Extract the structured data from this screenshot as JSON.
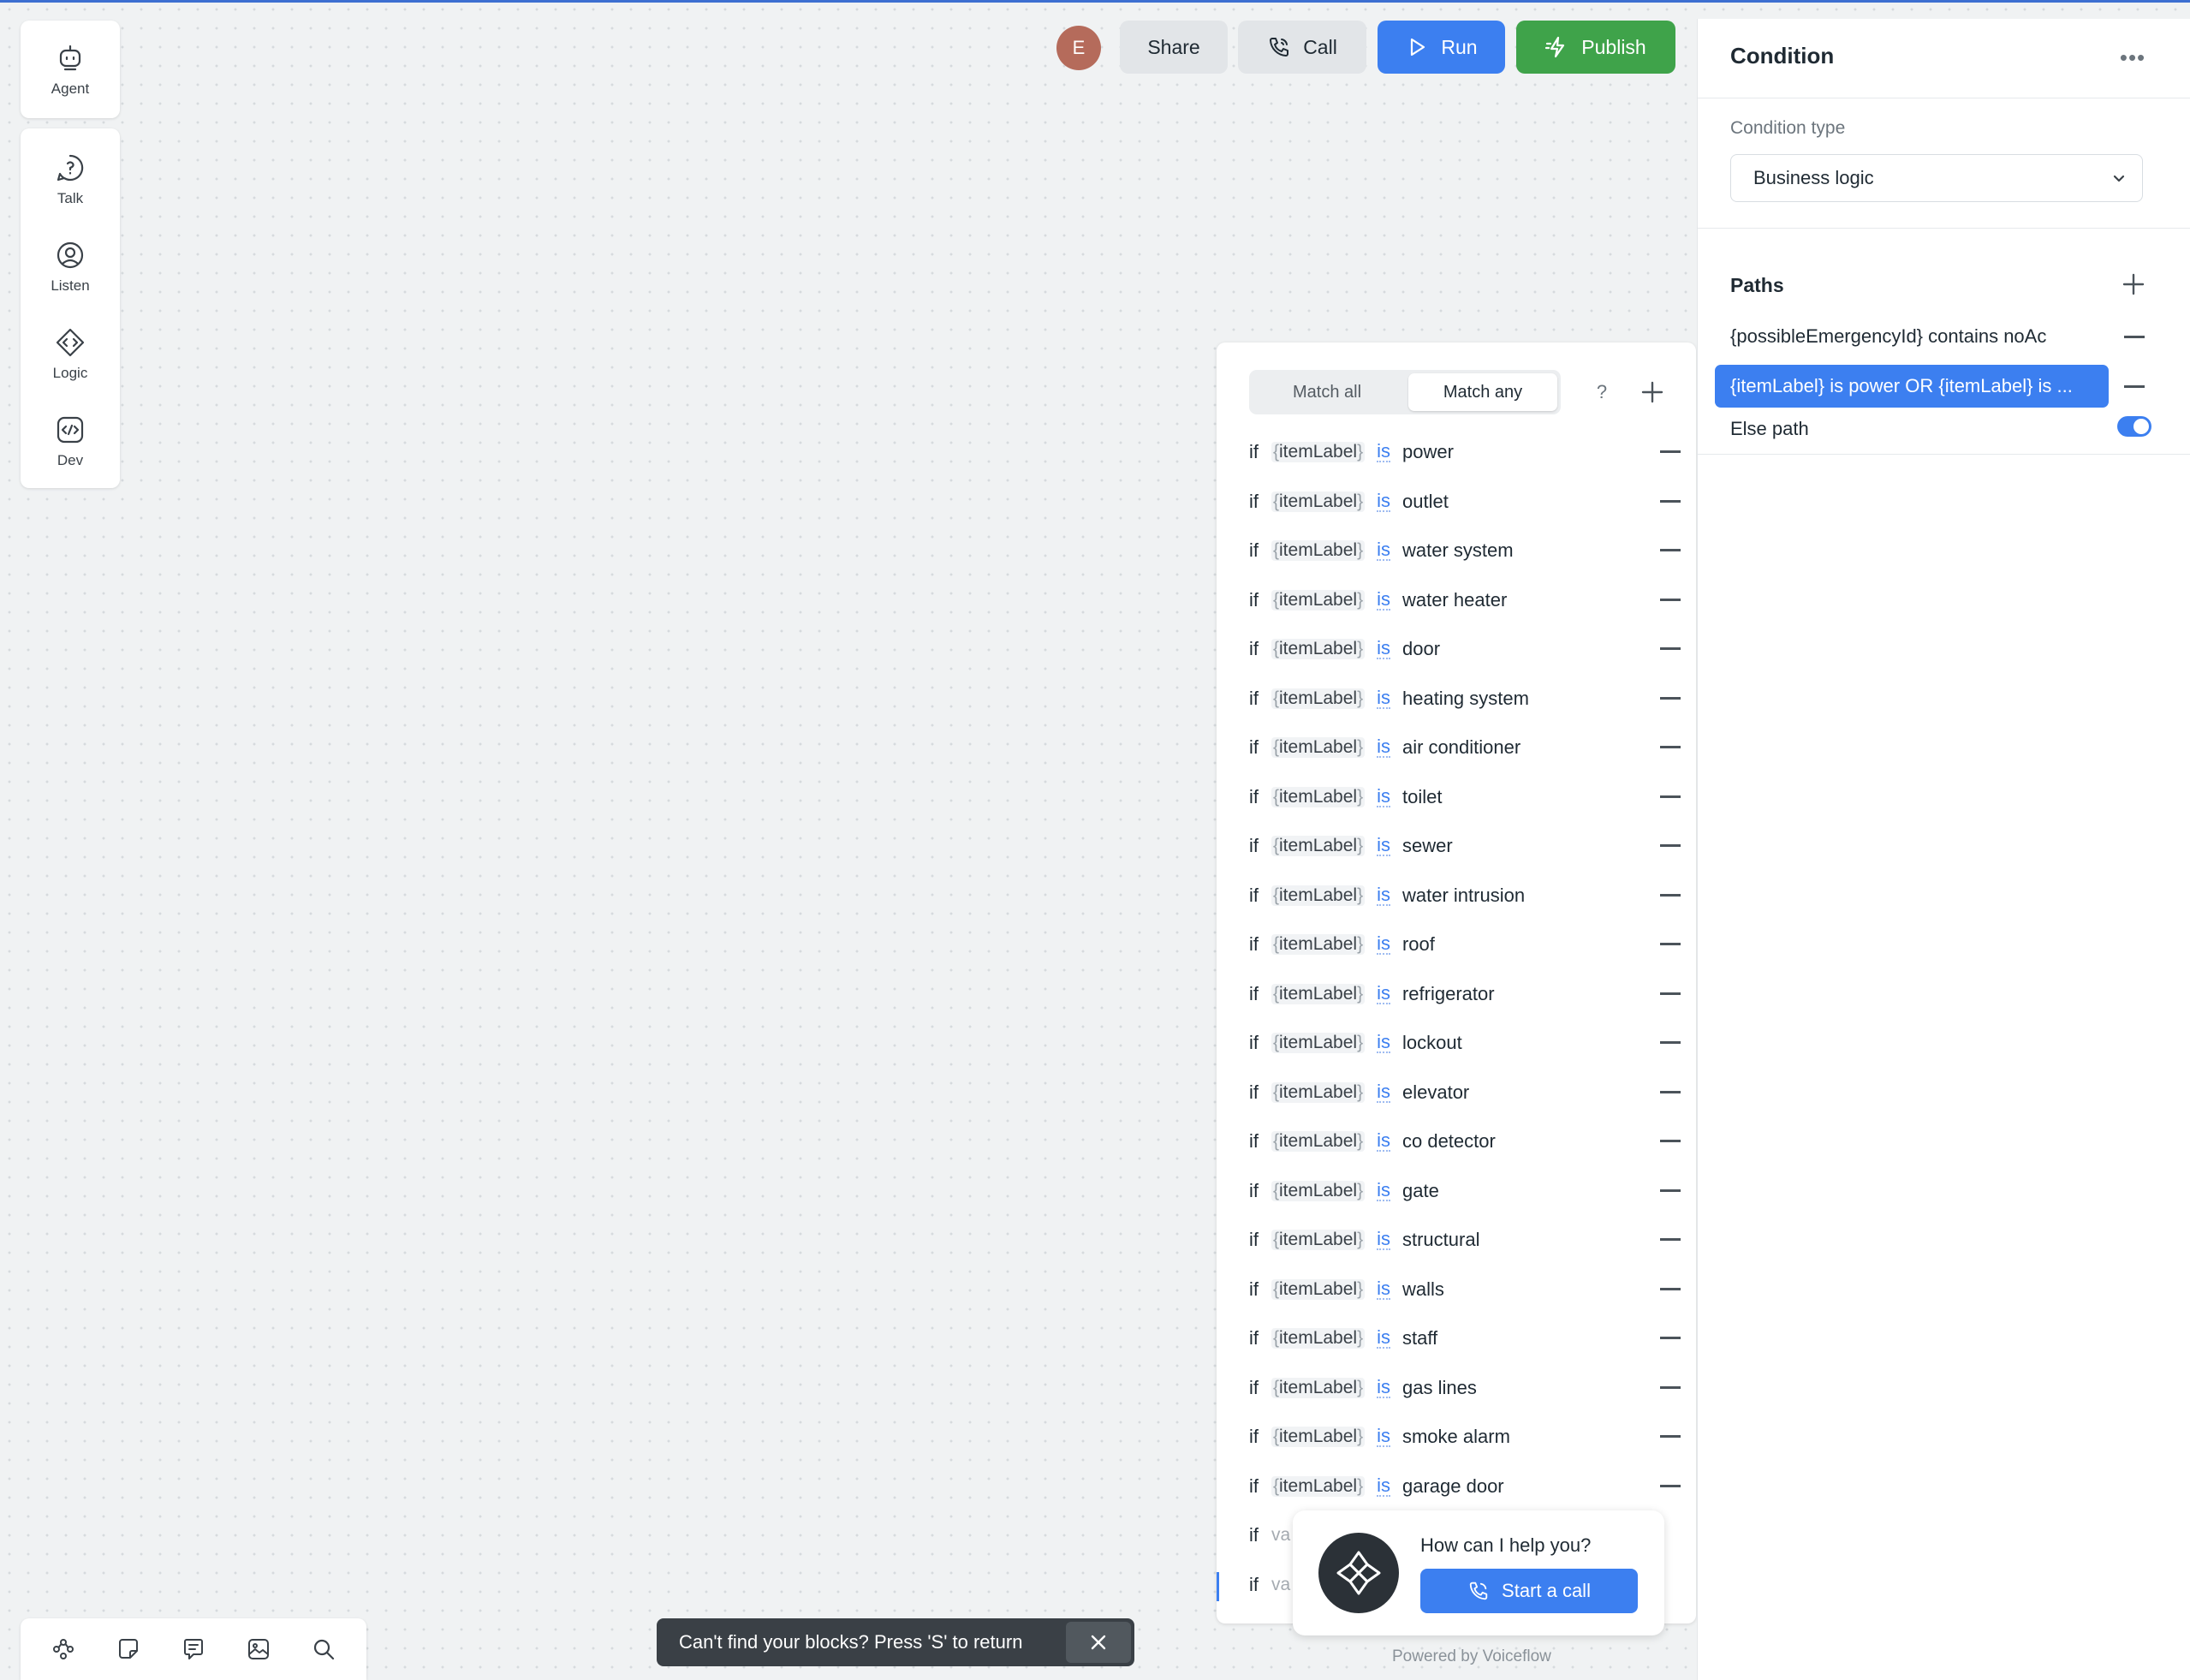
{
  "sidebar": {
    "agent": {
      "label": "Agent",
      "icon": "robot-icon"
    },
    "tools": [
      {
        "label": "Talk",
        "icon": "chat-bubble-icon"
      },
      {
        "label": "Listen",
        "icon": "user-circle-icon"
      },
      {
        "label": "Logic",
        "icon": "diamond-code-icon"
      },
      {
        "label": "Dev",
        "icon": "code-square-icon"
      }
    ]
  },
  "topbar": {
    "avatar_initial": "E",
    "share_label": "Share",
    "call_label": "Call",
    "run_label": "Run",
    "publish_label": "Publish"
  },
  "panel": {
    "title": "Condition",
    "condition_type_label": "Condition type",
    "condition_type_value": "Business logic",
    "paths_label": "Paths",
    "paths": [
      {
        "label": "{possibleEmergencyId} contains noAc",
        "selected": false
      },
      {
        "label": "{itemLabel} is power OR {itemLabel} is ...",
        "selected": true
      }
    ],
    "else_path_label": "Else path",
    "else_path_enabled": true
  },
  "conditions": {
    "match_all_label": "Match all",
    "match_any_label": "Match any",
    "selected_mode": "Match any",
    "help_label": "?",
    "if_label": "if",
    "variable": "itemLabel",
    "operator": "is",
    "rows": [
      "power",
      "outlet",
      "water system",
      "water heater",
      "door",
      "heating system",
      "air conditioner",
      "toilet",
      "sewer",
      "water intrusion",
      "roof",
      "refrigerator",
      "lockout",
      "elevator",
      "co detector",
      "gate",
      "structural",
      "walls",
      "staff",
      "gas lines",
      "smoke alarm",
      "garage door"
    ],
    "partial_rows": [
      "va",
      "va"
    ]
  },
  "chat_widget": {
    "question": "How can I help you?",
    "button_label": "Start a call",
    "powered_by": "Powered by Voiceflow"
  },
  "toast": {
    "message": "Can't find your blocks? Press 'S' to return"
  },
  "bottom_toolbar": {
    "icons": [
      "nodes-icon",
      "sticky-note-icon",
      "comment-icon",
      "image-icon",
      "search-icon"
    ]
  },
  "colors": {
    "accent": "#3c7ff0",
    "publish": "#3fa34a",
    "avatar": "#b56b5b",
    "toast": "#3a4046"
  }
}
